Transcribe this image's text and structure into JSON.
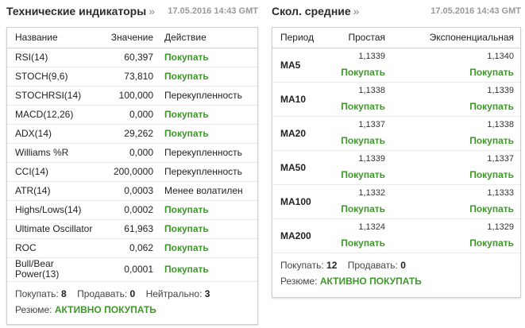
{
  "indicators": {
    "title": "Технические индикаторы",
    "arrow": "»",
    "date": "17.05.2016 14:43 GMT",
    "columns": {
      "name": "Название",
      "value": "Значение",
      "action": "Действие"
    },
    "rows": [
      {
        "name": "RSI(14)",
        "value": "60,397",
        "action": "Покупать",
        "kind": "buy"
      },
      {
        "name": "STOCH(9,6)",
        "value": "73,810",
        "action": "Покупать",
        "kind": "buy"
      },
      {
        "name": "STOCHRSI(14)",
        "value": "100,000",
        "action": "Перекупленность",
        "kind": "neutral"
      },
      {
        "name": "MACD(12,26)",
        "value": "0,000",
        "action": "Покупать",
        "kind": "buy"
      },
      {
        "name": "ADX(14)",
        "value": "29,262",
        "action": "Покупать",
        "kind": "buy"
      },
      {
        "name": "Williams %R",
        "value": "0,000",
        "action": "Перекупленность",
        "kind": "neutral"
      },
      {
        "name": "CCI(14)",
        "value": "200,0000",
        "action": "Перекупленность",
        "kind": "neutral"
      },
      {
        "name": "ATR(14)",
        "value": "0,0003",
        "action": "Менее волатилен",
        "kind": "neutral"
      },
      {
        "name": "Highs/Lows(14)",
        "value": "0,0002",
        "action": "Покупать",
        "kind": "buy"
      },
      {
        "name": "Ultimate Oscillator",
        "value": "61,963",
        "action": "Покупать",
        "kind": "buy"
      },
      {
        "name": "ROC",
        "value": "0,062",
        "action": "Покупать",
        "kind": "buy"
      },
      {
        "name": "Bull/Bear Power(13)",
        "value": "0,0001",
        "action": "Покупать",
        "kind": "buy"
      }
    ],
    "summary": {
      "buy_label": "Покупать:",
      "buy_count": "8",
      "sell_label": "Продавать:",
      "sell_count": "0",
      "neutral_label": "Нейтрально:",
      "neutral_count": "3",
      "result_label": "Резюме:",
      "result_value": "АКТИВНО ПОКУПАТЬ"
    }
  },
  "moving_averages": {
    "title": "Скол. средние",
    "arrow": "»",
    "date": "17.05.2016 14:43 GMT",
    "columns": {
      "period": "Период",
      "simple": "Простая",
      "exponential": "Экспоненциальная"
    },
    "rows": [
      {
        "period": "MA5",
        "simple": "1,1339",
        "simple_action": "Покупать",
        "exp": "1,1340",
        "exp_action": "Покупать"
      },
      {
        "period": "MA10",
        "simple": "1,1338",
        "simple_action": "Покупать",
        "exp": "1,1339",
        "exp_action": "Покупать"
      },
      {
        "period": "MA20",
        "simple": "1,1337",
        "simple_action": "Покупать",
        "exp": "1,1338",
        "exp_action": "Покупать"
      },
      {
        "period": "MA50",
        "simple": "1,1339",
        "simple_action": "Покупать",
        "exp": "1,1337",
        "exp_action": "Покупать"
      },
      {
        "period": "MA100",
        "simple": "1,1332",
        "simple_action": "Покупать",
        "exp": "1,1333",
        "exp_action": "Покупать"
      },
      {
        "period": "MA200",
        "simple": "1,1324",
        "simple_action": "Покупать",
        "exp": "1,1329",
        "exp_action": "Покупать"
      }
    ],
    "summary": {
      "buy_label": "Покупать:",
      "buy_count": "12",
      "sell_label": "Продавать:",
      "sell_count": "0",
      "result_label": "Резюме:",
      "result_value": "АКТИВНО ПОКУПАТЬ"
    }
  },
  "colors": {
    "buy": "#3c9a26",
    "border": "#cfcfcf",
    "date": "#999999"
  }
}
